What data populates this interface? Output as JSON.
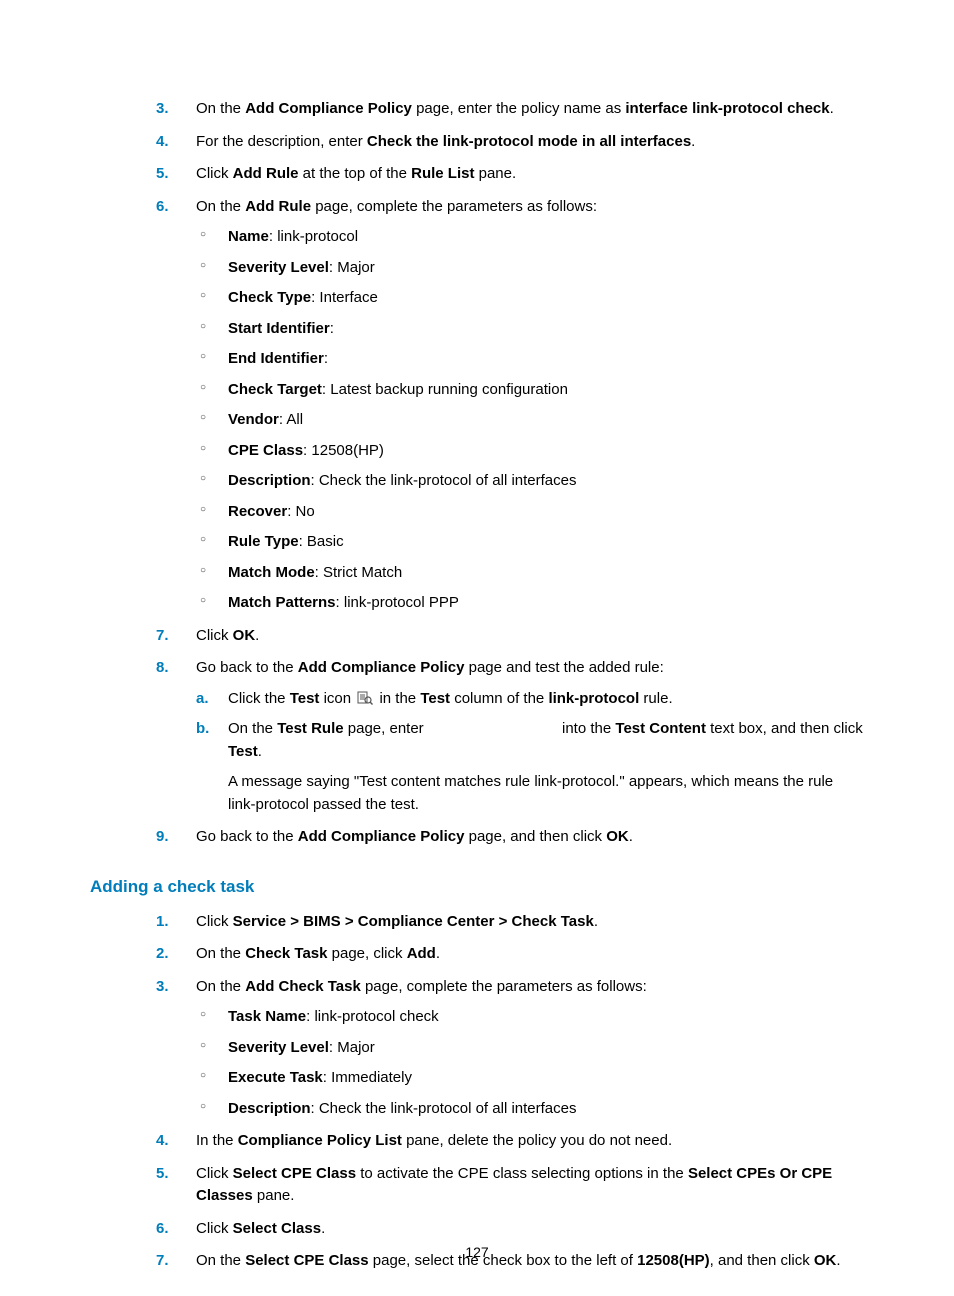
{
  "page_number": "127",
  "section1": {
    "steps": [
      {
        "num": "3.",
        "segs": [
          {
            "t": "On the "
          },
          {
            "t": "Add Compliance Policy",
            "b": true
          },
          {
            "t": " page, enter the policy name as "
          },
          {
            "t": "interface link-protocol check",
            "b": true
          },
          {
            "t": "."
          }
        ]
      },
      {
        "num": "4.",
        "segs": [
          {
            "t": "For the description, enter "
          },
          {
            "t": "Check the link-protocol mode in all interfaces",
            "b": true
          },
          {
            "t": "."
          }
        ]
      },
      {
        "num": "5.",
        "segs": [
          {
            "t": "Click "
          },
          {
            "t": "Add Rule",
            "b": true
          },
          {
            "t": " at the top of the "
          },
          {
            "t": "Rule List",
            "b": true
          },
          {
            "t": " pane."
          }
        ]
      },
      {
        "num": "6.",
        "segs": [
          {
            "t": "On the "
          },
          {
            "t": "Add Rule",
            "b": true
          },
          {
            "t": " page, complete the parameters as follows:"
          }
        ],
        "bullets": [
          [
            {
              "t": "Name",
              "b": true
            },
            {
              "t": ": link-protocol"
            }
          ],
          [
            {
              "t": "Severity Level",
              "b": true
            },
            {
              "t": ": Major"
            }
          ],
          [
            {
              "t": "Check Type",
              "b": true
            },
            {
              "t": ": Interface"
            }
          ],
          [
            {
              "t": "Start Identifier",
              "b": true
            },
            {
              "t": ":"
            }
          ],
          [
            {
              "t": "End Identifier",
              "b": true
            },
            {
              "t": ":"
            }
          ],
          [
            {
              "t": "Check Target",
              "b": true
            },
            {
              "t": ": Latest backup running configuration"
            }
          ],
          [
            {
              "t": "Vendor",
              "b": true
            },
            {
              "t": ": All"
            }
          ],
          [
            {
              "t": "CPE Class",
              "b": true
            },
            {
              "t": ": 12508(HP)"
            }
          ],
          [
            {
              "t": "Description",
              "b": true
            },
            {
              "t": ": Check the link-protocol of all interfaces"
            }
          ],
          [
            {
              "t": "Recover",
              "b": true
            },
            {
              "t": ": No"
            }
          ],
          [
            {
              "t": "Rule Type",
              "b": true
            },
            {
              "t": ": Basic"
            }
          ],
          [
            {
              "t": "Match Mode",
              "b": true
            },
            {
              "t": ": Strict Match"
            }
          ],
          [
            {
              "t": "Match Patterns",
              "b": true
            },
            {
              "t": ": link-protocol PPP"
            }
          ]
        ]
      },
      {
        "num": "7.",
        "segs": [
          {
            "t": "Click "
          },
          {
            "t": "OK",
            "b": true
          },
          {
            "t": "."
          }
        ]
      },
      {
        "num": "8.",
        "segs": [
          {
            "t": "Go back to the "
          },
          {
            "t": "Add Compliance Policy",
            "b": true
          },
          {
            "t": " page and test the added rule:"
          }
        ],
        "alpha": [
          {
            "a": "a.",
            "segs": [
              {
                "t": "Click the "
              },
              {
                "t": "Test",
                "b": true
              },
              {
                "t": " icon "
              },
              {
                "icon": true
              },
              {
                "t": " in the "
              },
              {
                "t": "Test",
                "b": true
              },
              {
                "t": " column of the "
              },
              {
                "t": "link-protocol",
                "b": true
              },
              {
                "t": " rule."
              }
            ]
          },
          {
            "a": "b.",
            "segs": [
              {
                "t": "On the "
              },
              {
                "t": "Test Rule",
                "b": true
              },
              {
                "t": " page, enter "
              },
              {
                "gap": true
              },
              {
                "t": " into the "
              },
              {
                "t": "Test Content",
                "b": true
              },
              {
                "t": " text box, and then click "
              },
              {
                "t": "Test",
                "b": true
              },
              {
                "t": "."
              }
            ],
            "note": "A message saying \"Test content matches rule link-protocol.\" appears, which means the rule link-protocol passed the test."
          }
        ]
      },
      {
        "num": "9.",
        "segs": [
          {
            "t": "Go back to the "
          },
          {
            "t": "Add Compliance Policy",
            "b": true
          },
          {
            "t": " page, and then click "
          },
          {
            "t": "OK",
            "b": true
          },
          {
            "t": "."
          }
        ]
      }
    ]
  },
  "section2": {
    "heading": "Adding a check task",
    "steps": [
      {
        "num": "1.",
        "segs": [
          {
            "t": "Click "
          },
          {
            "t": "Service > BIMS > Compliance Center > Check Task",
            "b": true
          },
          {
            "t": "."
          }
        ]
      },
      {
        "num": "2.",
        "segs": [
          {
            "t": "On the "
          },
          {
            "t": "Check Task",
            "b": true
          },
          {
            "t": " page, click "
          },
          {
            "t": "Add",
            "b": true
          },
          {
            "t": "."
          }
        ]
      },
      {
        "num": "3.",
        "segs": [
          {
            "t": "On the "
          },
          {
            "t": "Add Check Task",
            "b": true
          },
          {
            "t": " page, complete the parameters as follows:"
          }
        ],
        "bullets": [
          [
            {
              "t": "Task Name",
              "b": true
            },
            {
              "t": ": link-protocol check"
            }
          ],
          [
            {
              "t": "Severity Level",
              "b": true
            },
            {
              "t": ": Major"
            }
          ],
          [
            {
              "t": "Execute Task",
              "b": true
            },
            {
              "t": ": Immediately"
            }
          ],
          [
            {
              "t": "Description",
              "b": true
            },
            {
              "t": ": Check the link-protocol of all interfaces"
            }
          ]
        ]
      },
      {
        "num": "4.",
        "segs": [
          {
            "t": "In the "
          },
          {
            "t": "Compliance Policy List",
            "b": true
          },
          {
            "t": " pane, delete the policy you do not need."
          }
        ]
      },
      {
        "num": "5.",
        "segs": [
          {
            "t": "Click "
          },
          {
            "t": "Select CPE Class",
            "b": true
          },
          {
            "t": " to activate the CPE class selecting options in the "
          },
          {
            "t": "Select CPEs Or CPE Classes",
            "b": true
          },
          {
            "t": " pane."
          }
        ]
      },
      {
        "num": "6.",
        "segs": [
          {
            "t": "Click "
          },
          {
            "t": "Select Class",
            "b": true
          },
          {
            "t": "."
          }
        ]
      },
      {
        "num": "7.",
        "segs": [
          {
            "t": "On the "
          },
          {
            "t": "Select CPE Class",
            "b": true
          },
          {
            "t": " page, select the check box to the left of "
          },
          {
            "t": "12508(HP)",
            "b": true
          },
          {
            "t": ", and then click "
          },
          {
            "t": "OK",
            "b": true
          },
          {
            "t": "."
          }
        ]
      }
    ]
  }
}
